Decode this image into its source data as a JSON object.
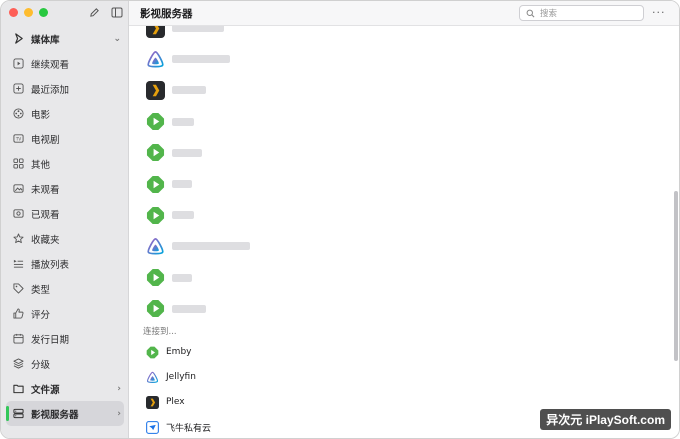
{
  "sidebar": {
    "items": [
      {
        "name": "sidebar-section-media-library",
        "label": "媒体库",
        "icon": "media-library-icon",
        "section": true,
        "chevron": "down"
      },
      {
        "name": "sidebar-item-continue-watching",
        "label": "继续观看",
        "icon": "play-square-icon"
      },
      {
        "name": "sidebar-item-recently-added",
        "label": "最近添加",
        "icon": "plus-square-icon"
      },
      {
        "name": "sidebar-item-movies",
        "label": "电影",
        "icon": "film-reel-icon"
      },
      {
        "name": "sidebar-item-tv-shows",
        "label": "电视剧",
        "icon": "tv-icon"
      },
      {
        "name": "sidebar-item-others",
        "label": "其他",
        "icon": "grid-icon"
      },
      {
        "name": "sidebar-item-unwatched",
        "label": "未观看",
        "icon": "picture-icon"
      },
      {
        "name": "sidebar-item-watched",
        "label": "已观看",
        "icon": "eye-icon"
      },
      {
        "name": "sidebar-item-favorites",
        "label": "收藏夹",
        "icon": "star-icon"
      },
      {
        "name": "sidebar-item-playlists",
        "label": "播放列表",
        "icon": "playlist-icon"
      },
      {
        "name": "sidebar-item-genres",
        "label": "类型",
        "icon": "tag-icon"
      },
      {
        "name": "sidebar-item-ratings",
        "label": "评分",
        "icon": "thumbs-up-icon"
      },
      {
        "name": "sidebar-item-release-date",
        "label": "发行日期",
        "icon": "calendar-icon"
      },
      {
        "name": "sidebar-item-tiers",
        "label": "分级",
        "icon": "layers-icon"
      },
      {
        "name": "sidebar-section-file-sources",
        "label": "文件源",
        "icon": "folder-icon",
        "section": true,
        "chevron": "right"
      },
      {
        "name": "sidebar-section-media-servers",
        "label": "影视服务器",
        "icon": "server-icon",
        "section": true,
        "chevron": "right",
        "active": true
      }
    ]
  },
  "main": {
    "title": "影视服务器",
    "search_placeholder": "搜索",
    "servers": [
      {
        "type": "plex",
        "icon": "plex-icon"
      },
      {
        "type": "jellyfin",
        "icon": "jellyfin-icon"
      },
      {
        "type": "plex",
        "icon": "plex-icon"
      },
      {
        "type": "emby",
        "icon": "emby-icon"
      },
      {
        "type": "emby",
        "icon": "emby-icon"
      },
      {
        "type": "emby",
        "icon": "emby-icon"
      },
      {
        "type": "emby",
        "icon": "emby-icon"
      },
      {
        "type": "jellyfin",
        "icon": "jellyfin-icon"
      },
      {
        "type": "emby",
        "icon": "emby-icon"
      },
      {
        "type": "emby",
        "icon": "emby-icon"
      }
    ],
    "connect_title": "连接到...",
    "connect_options": [
      {
        "label": "Emby",
        "icon": "emby-icon"
      },
      {
        "label": "Jellyfin",
        "icon": "jellyfin-icon"
      },
      {
        "label": "Plex",
        "icon": "plex-icon"
      },
      {
        "label": "飞牛私有云",
        "icon": "feiniu-cloud-icon"
      }
    ]
  },
  "watermark": "异次元 iPlaySoft.com",
  "colors": {
    "emby": "#52b54b",
    "jellyfin_a": "#aa5cc3",
    "jellyfin_b": "#00a4dc",
    "plex_bg": "#282a2d",
    "plex_chevron": "#e5a00d",
    "active_indicator": "#33c759",
    "feiniu": "#1a73e8"
  }
}
